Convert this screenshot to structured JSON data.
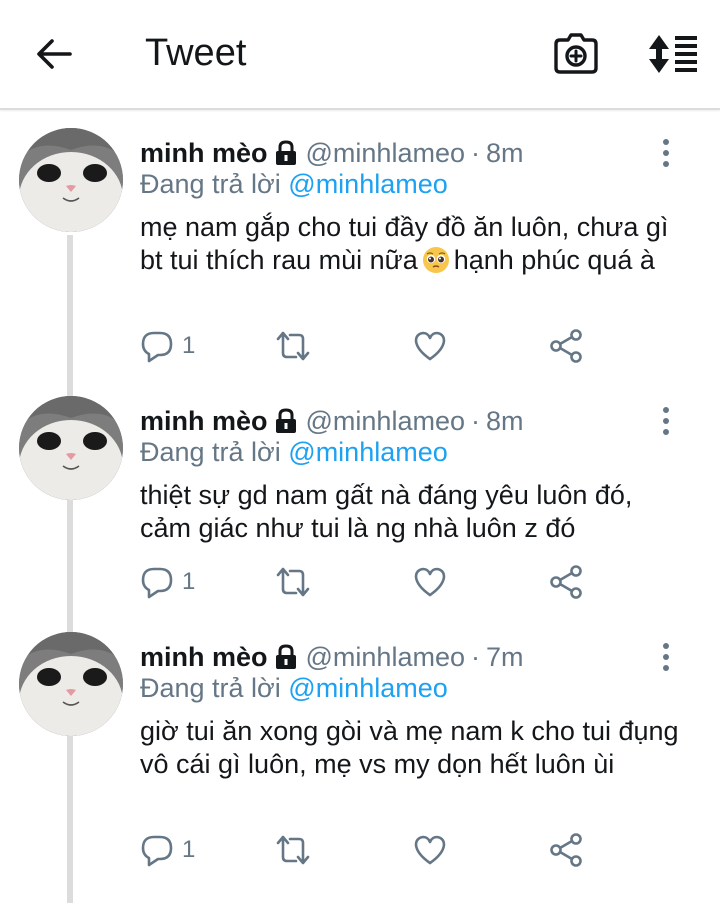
{
  "header": {
    "title": "Tweet",
    "back_icon": "arrow-left-icon",
    "camera_icon": "camera-add-icon",
    "sort_icon": "sort-order-icon"
  },
  "colors": {
    "link": "#1da1f2",
    "muted": "#657786",
    "text": "#14171a"
  },
  "tweets": [
    {
      "display_name": "minh mèo",
      "handle": "@minhlameo",
      "separator": "·",
      "time": "8m",
      "reply_prefix": "Đang trả lời",
      "reply_to": "@minhlameo",
      "text_before_emoji": "mẹ nam gắp cho tui đầy đồ ăn luôn, chưa gì bt tui thích rau mùi nữa",
      "emoji": "pleading-face-emoji",
      "text_after_emoji": "hạnh phúc quá à",
      "reply_count": "1"
    },
    {
      "display_name": "minh mèo",
      "handle": "@minhlameo",
      "separator": "·",
      "time": "8m",
      "reply_prefix": "Đang trả lời",
      "reply_to": "@minhlameo",
      "text": "thiệt sự gd nam gất nà đáng yêu luôn đó, cảm giác như tui là ng nhà luôn z đó",
      "reply_count": "1"
    },
    {
      "display_name": "minh mèo",
      "handle": "@minhlameo",
      "separator": "·",
      "time": "7m",
      "reply_prefix": "Đang trả lời",
      "reply_to": "@minhlameo",
      "text": "giờ tui ăn xong gòi và mẹ nam k cho tui đụng vô cái gì luôn, mẹ vs my dọn hết luôn ùi",
      "reply_count": "1"
    }
  ]
}
